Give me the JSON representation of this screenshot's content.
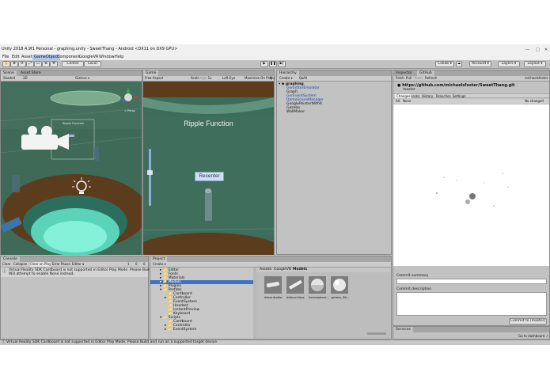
{
  "window": {
    "title": "Unity 2018.4.9f1 Personal - graphing.unity - SweetThang - Android <DX11 on DX9 GPU>",
    "controls": [
      "—",
      "□",
      "✕"
    ]
  },
  "menu": [
    "File",
    "Edit",
    "Assets",
    "GameObject",
    "Component",
    "GoogleVR",
    "Window",
    "Help"
  ],
  "toolbar": {
    "pivot": "Center",
    "space": "Local",
    "collab": "Collab ▾",
    "account": "Account ▾",
    "layers": "Layers ▾",
    "layout": "Layout ▾"
  },
  "scene": {
    "tabs": [
      "Scene",
      "Asset Store"
    ],
    "shading": "Shaded",
    "mode": "2D",
    "gizmos": "Gizmos ▾",
    "persp": "< Persp",
    "label_tag": "Ripple Function"
  },
  "game": {
    "tab": "Game",
    "aspect": "Free Aspect",
    "scale": "Scale ─○─ 1x",
    "left_eye": "Left Eye",
    "maximize": "Maximize On Play",
    "mute": "Mu",
    "title": "Ripple Function",
    "button": "Recenter"
  },
  "hierarchy": {
    "tab": "Hierarchy",
    "create": "Create ▾",
    "search": "Q▾All",
    "root": "graphing",
    "items": [
      {
        "label": "GvrEditorEmulator",
        "blue": true
      },
      {
        "label": "Graph",
        "blue": false
      },
      {
        "label": "GvrEventSystem",
        "blue": true
      },
      {
        "label": "DemoSceneManager",
        "blue": true
      },
      {
        "label": "GooglePointerWithR",
        "blue": false
      },
      {
        "label": "Gazebo",
        "blue": false
      },
      {
        "label": "WallMaker",
        "blue": false
      }
    ]
  },
  "github": {
    "tabs": [
      "Inspector",
      "GitHub"
    ],
    "fetch": "Fetch",
    "pull": "Pull",
    "push": "Push",
    "refresh": "Refresh",
    "user": "michaelsfoster",
    "repo_url": "https://github.com/michaelsfoster/SweetThang.git",
    "branch": "master",
    "subtabs": [
      "Changes",
      "Locks",
      "History",
      "Branches",
      "Settings"
    ],
    "all": "All",
    "none": "None",
    "no_changes": "No changed files",
    "commit_summary_label": "Commit summary",
    "commit_description_label": "Commit description",
    "commit_button": "Commit to [master]",
    "services_tab": "Services",
    "go_to_dashboard": "Go to dashboard ↗"
  },
  "console": {
    "tab": "Console",
    "clear": "Clear",
    "collapse": "Collapse",
    "clear_on_play": "Clear on Play",
    "error_pause": "Error Pause",
    "editor": "Editor ▾",
    "counts": [
      "1",
      "0",
      "0"
    ],
    "message_line1": "Virtual Reality SDK Cardboard is not supported in Editor Play Mode. Please Build and",
    "message_line2": "Will attempt to enable None instead."
  },
  "project": {
    "tab": "Project",
    "create": "Create ▾",
    "tree": [
      {
        "label": "Editor",
        "depth": 1
      },
      {
        "label": "Fonts",
        "depth": 1
      },
      {
        "label": "Materials",
        "depth": 1
      },
      {
        "label": "Models",
        "depth": 1,
        "selected": true
      },
      {
        "label": "Plugins",
        "depth": 1
      },
      {
        "label": "Prefabs",
        "depth": 1
      },
      {
        "label": "Cardboard",
        "depth": 2
      },
      {
        "label": "Controller",
        "depth": 2
      },
      {
        "label": "EventSystem",
        "depth": 2
      },
      {
        "label": "Headset",
        "depth": 2
      },
      {
        "label": "InstantPreview",
        "depth": 2
      },
      {
        "label": "Keyboard",
        "depth": 2
      },
      {
        "label": "Scripts",
        "depth": 1
      },
      {
        "label": "Cardboard",
        "depth": 2
      },
      {
        "label": "Controller",
        "depth": 2
      },
      {
        "label": "EventSystem",
        "depth": 2
      }
    ],
    "breadcrumb": [
      "Assets",
      "GoogleVR",
      "Models"
    ],
    "assets": [
      "ddcontroller",
      "ddtouchtips",
      "hemisphere...",
      "sphere_36..."
    ]
  },
  "status": {
    "message": "Virtual Reality SDK Cardboard is not supported in Editor Play Mode. Please Build and run on a supported target device."
  },
  "colors": {
    "editor_bg": "#c2c2c2",
    "scene_ground": "#3f6a58",
    "scene_wall": "#5b3c1c",
    "link_blue": "#1a47a0",
    "selection": "#3d74c6"
  }
}
